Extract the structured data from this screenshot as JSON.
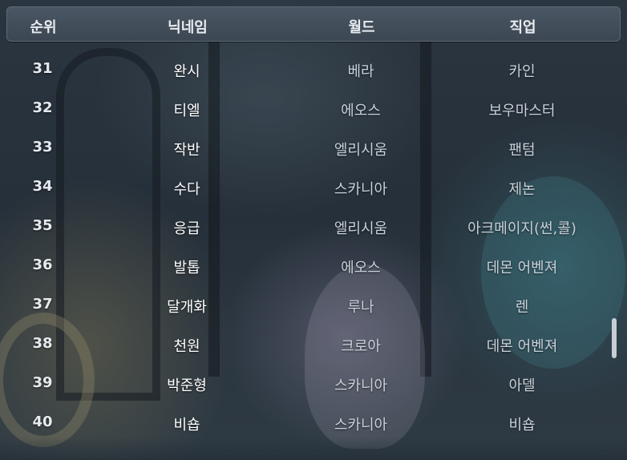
{
  "header": {
    "rank": "순위",
    "nickname": "닉네임",
    "world": "월드",
    "job": "직업"
  },
  "rows": [
    {
      "rank": "31",
      "nickname": "완시",
      "world": "베라",
      "job": "카인"
    },
    {
      "rank": "32",
      "nickname": "티엘",
      "world": "에오스",
      "job": "보우마스터"
    },
    {
      "rank": "33",
      "nickname": "작반",
      "world": "엘리시움",
      "job": "팬텀"
    },
    {
      "rank": "34",
      "nickname": "수다",
      "world": "스카니아",
      "job": "제논"
    },
    {
      "rank": "35",
      "nickname": "응급",
      "world": "엘리시움",
      "job": "아크메이지(썬,콜)"
    },
    {
      "rank": "36",
      "nickname": "발톱",
      "world": "에오스",
      "job": "데몬 어벤져"
    },
    {
      "rank": "37",
      "nickname": "달개화",
      "world": "루나",
      "job": "렌"
    },
    {
      "rank": "38",
      "nickname": "천원",
      "world": "크로아",
      "job": "데몬 어벤져"
    },
    {
      "rank": "39",
      "nickname": "박준형",
      "world": "스카니아",
      "job": "아델"
    },
    {
      "rank": "40",
      "nickname": "비숍",
      "world": "스카니아",
      "job": "비숍"
    }
  ],
  "scrollbar": {
    "position_fraction": 0.75
  }
}
